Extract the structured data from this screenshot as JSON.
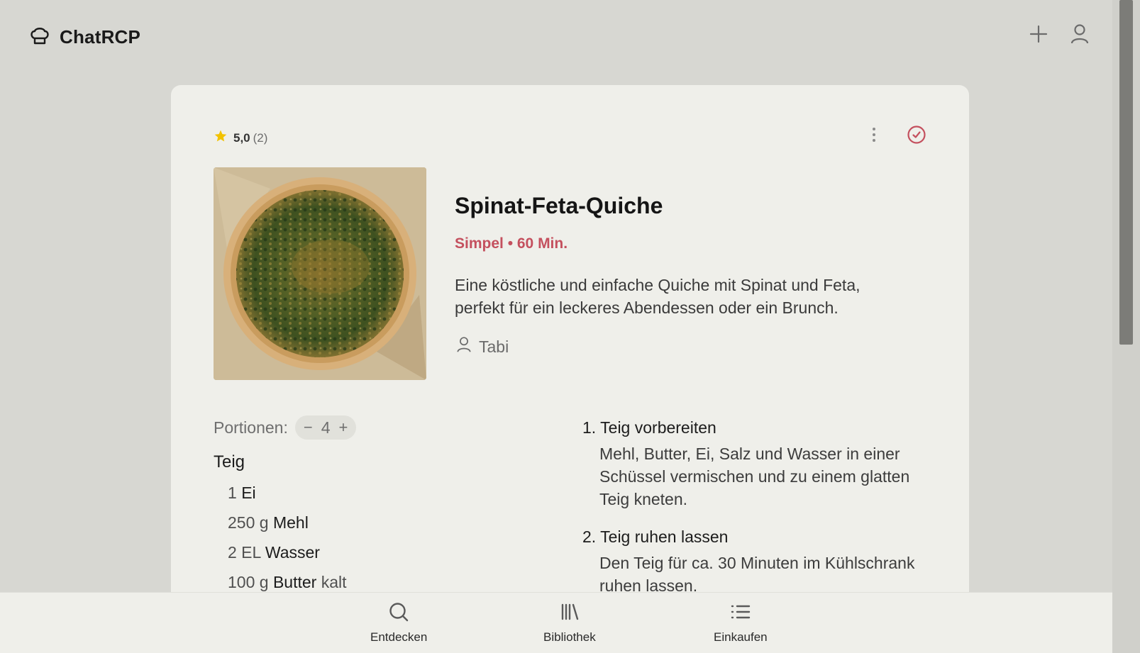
{
  "header": {
    "brand": "ChatRCP"
  },
  "recipe": {
    "rating": "5,0",
    "rating_count": "(2)",
    "title": "Spinat-Feta-Quiche",
    "meta": "Simpel • 60 Min.",
    "description": "Eine köstliche und einfache Quiche mit Spinat und Feta, perfekt für ein leckeres Abendessen oder ein Brunch.",
    "author": "Tabi",
    "portions_label": "Portionen:",
    "portions_value": "4",
    "stepper_minus": "−",
    "stepper_plus": "+",
    "ingredient_group": "Teig",
    "ingredients": [
      {
        "qty": "1",
        "name": "Ei",
        "note": ""
      },
      {
        "qty": "250 g",
        "name": "Mehl",
        "note": ""
      },
      {
        "qty": "2 EL",
        "name": "Wasser",
        "note": ""
      },
      {
        "qty": "100 g",
        "name": "Butter",
        "note": "kalt"
      }
    ],
    "steps": [
      {
        "title": "1. Teig vorbereiten",
        "text": "Mehl, Butter, Ei, Salz und Wasser in einer Schüssel vermischen und zu einem glatten Teig kneten."
      },
      {
        "title": "2. Teig ruhen lassen",
        "text": "Den Teig für ca. 30 Minuten im Kühlschrank ruhen lassen."
      }
    ]
  },
  "bottom_nav": [
    {
      "label": "Entdecken",
      "icon": "search-icon"
    },
    {
      "label": "Bibliothek",
      "icon": "library-icon"
    },
    {
      "label": "Einkaufen",
      "icon": "list-icon"
    }
  ],
  "colors": {
    "accent": "#c4505e",
    "star": "#f2c200",
    "background": "#d7d7d2",
    "card": "#efefea"
  }
}
